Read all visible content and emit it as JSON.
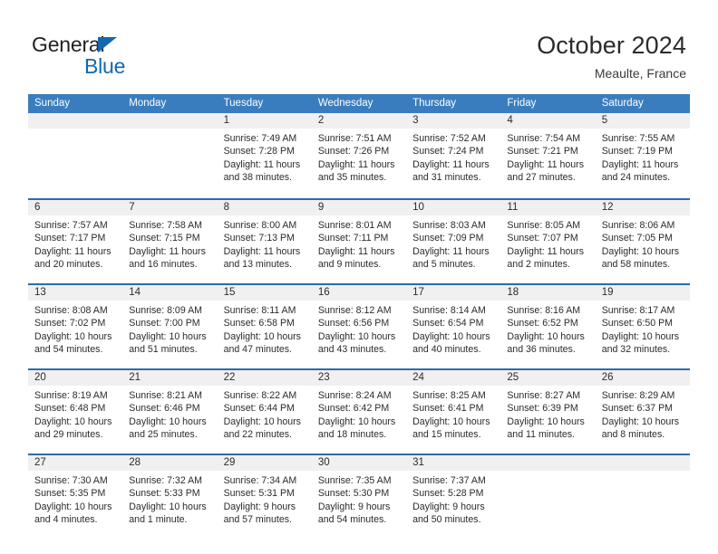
{
  "brand": {
    "name_part1": "General",
    "name_part2": "Blue",
    "triangle_icon": "blue-triangle-icon",
    "color_dark": "#231f20",
    "color_blue": "#1269b0"
  },
  "header": {
    "title": "October 2024",
    "subtitle": "Meaulte, France"
  },
  "theme": {
    "header_bg": "#3a7dbf",
    "row_divider": "#2b6ca8",
    "day_band_bg": "#f0f0f0",
    "text": "#2b2b2b"
  },
  "weekdays": [
    "Sunday",
    "Monday",
    "Tuesday",
    "Wednesday",
    "Thursday",
    "Friday",
    "Saturday"
  ],
  "weeks": [
    [
      {
        "day": "",
        "empty": true,
        "sunrise": "",
        "sunset": "",
        "daylight_line1": "",
        "daylight_line2": ""
      },
      {
        "day": "",
        "empty": true,
        "sunrise": "",
        "sunset": "",
        "daylight_line1": "",
        "daylight_line2": ""
      },
      {
        "day": "1",
        "sunrise": "Sunrise: 7:49 AM",
        "sunset": "Sunset: 7:28 PM",
        "daylight_line1": "Daylight: 11 hours",
        "daylight_line2": "and 38 minutes."
      },
      {
        "day": "2",
        "sunrise": "Sunrise: 7:51 AM",
        "sunset": "Sunset: 7:26 PM",
        "daylight_line1": "Daylight: 11 hours",
        "daylight_line2": "and 35 minutes."
      },
      {
        "day": "3",
        "sunrise": "Sunrise: 7:52 AM",
        "sunset": "Sunset: 7:24 PM",
        "daylight_line1": "Daylight: 11 hours",
        "daylight_line2": "and 31 minutes."
      },
      {
        "day": "4",
        "sunrise": "Sunrise: 7:54 AM",
        "sunset": "Sunset: 7:21 PM",
        "daylight_line1": "Daylight: 11 hours",
        "daylight_line2": "and 27 minutes."
      },
      {
        "day": "5",
        "sunrise": "Sunrise: 7:55 AM",
        "sunset": "Sunset: 7:19 PM",
        "daylight_line1": "Daylight: 11 hours",
        "daylight_line2": "and 24 minutes."
      }
    ],
    [
      {
        "day": "6",
        "sunrise": "Sunrise: 7:57 AM",
        "sunset": "Sunset: 7:17 PM",
        "daylight_line1": "Daylight: 11 hours",
        "daylight_line2": "and 20 minutes."
      },
      {
        "day": "7",
        "sunrise": "Sunrise: 7:58 AM",
        "sunset": "Sunset: 7:15 PM",
        "daylight_line1": "Daylight: 11 hours",
        "daylight_line2": "and 16 minutes."
      },
      {
        "day": "8",
        "sunrise": "Sunrise: 8:00 AM",
        "sunset": "Sunset: 7:13 PM",
        "daylight_line1": "Daylight: 11 hours",
        "daylight_line2": "and 13 minutes."
      },
      {
        "day": "9",
        "sunrise": "Sunrise: 8:01 AM",
        "sunset": "Sunset: 7:11 PM",
        "daylight_line1": "Daylight: 11 hours",
        "daylight_line2": "and 9 minutes."
      },
      {
        "day": "10",
        "sunrise": "Sunrise: 8:03 AM",
        "sunset": "Sunset: 7:09 PM",
        "daylight_line1": "Daylight: 11 hours",
        "daylight_line2": "and 5 minutes."
      },
      {
        "day": "11",
        "sunrise": "Sunrise: 8:05 AM",
        "sunset": "Sunset: 7:07 PM",
        "daylight_line1": "Daylight: 11 hours",
        "daylight_line2": "and 2 minutes."
      },
      {
        "day": "12",
        "sunrise": "Sunrise: 8:06 AM",
        "sunset": "Sunset: 7:05 PM",
        "daylight_line1": "Daylight: 10 hours",
        "daylight_line2": "and 58 minutes."
      }
    ],
    [
      {
        "day": "13",
        "sunrise": "Sunrise: 8:08 AM",
        "sunset": "Sunset: 7:02 PM",
        "daylight_line1": "Daylight: 10 hours",
        "daylight_line2": "and 54 minutes."
      },
      {
        "day": "14",
        "sunrise": "Sunrise: 8:09 AM",
        "sunset": "Sunset: 7:00 PM",
        "daylight_line1": "Daylight: 10 hours",
        "daylight_line2": "and 51 minutes."
      },
      {
        "day": "15",
        "sunrise": "Sunrise: 8:11 AM",
        "sunset": "Sunset: 6:58 PM",
        "daylight_line1": "Daylight: 10 hours",
        "daylight_line2": "and 47 minutes."
      },
      {
        "day": "16",
        "sunrise": "Sunrise: 8:12 AM",
        "sunset": "Sunset: 6:56 PM",
        "daylight_line1": "Daylight: 10 hours",
        "daylight_line2": "and 43 minutes."
      },
      {
        "day": "17",
        "sunrise": "Sunrise: 8:14 AM",
        "sunset": "Sunset: 6:54 PM",
        "daylight_line1": "Daylight: 10 hours",
        "daylight_line2": "and 40 minutes."
      },
      {
        "day": "18",
        "sunrise": "Sunrise: 8:16 AM",
        "sunset": "Sunset: 6:52 PM",
        "daylight_line1": "Daylight: 10 hours",
        "daylight_line2": "and 36 minutes."
      },
      {
        "day": "19",
        "sunrise": "Sunrise: 8:17 AM",
        "sunset": "Sunset: 6:50 PM",
        "daylight_line1": "Daylight: 10 hours",
        "daylight_line2": "and 32 minutes."
      }
    ],
    [
      {
        "day": "20",
        "sunrise": "Sunrise: 8:19 AM",
        "sunset": "Sunset: 6:48 PM",
        "daylight_line1": "Daylight: 10 hours",
        "daylight_line2": "and 29 minutes."
      },
      {
        "day": "21",
        "sunrise": "Sunrise: 8:21 AM",
        "sunset": "Sunset: 6:46 PM",
        "daylight_line1": "Daylight: 10 hours",
        "daylight_line2": "and 25 minutes."
      },
      {
        "day": "22",
        "sunrise": "Sunrise: 8:22 AM",
        "sunset": "Sunset: 6:44 PM",
        "daylight_line1": "Daylight: 10 hours",
        "daylight_line2": "and 22 minutes."
      },
      {
        "day": "23",
        "sunrise": "Sunrise: 8:24 AM",
        "sunset": "Sunset: 6:42 PM",
        "daylight_line1": "Daylight: 10 hours",
        "daylight_line2": "and 18 minutes."
      },
      {
        "day": "24",
        "sunrise": "Sunrise: 8:25 AM",
        "sunset": "Sunset: 6:41 PM",
        "daylight_line1": "Daylight: 10 hours",
        "daylight_line2": "and 15 minutes."
      },
      {
        "day": "25",
        "sunrise": "Sunrise: 8:27 AM",
        "sunset": "Sunset: 6:39 PM",
        "daylight_line1": "Daylight: 10 hours",
        "daylight_line2": "and 11 minutes."
      },
      {
        "day": "26",
        "sunrise": "Sunrise: 8:29 AM",
        "sunset": "Sunset: 6:37 PM",
        "daylight_line1": "Daylight: 10 hours",
        "daylight_line2": "and 8 minutes."
      }
    ],
    [
      {
        "day": "27",
        "sunrise": "Sunrise: 7:30 AM",
        "sunset": "Sunset: 5:35 PM",
        "daylight_line1": "Daylight: 10 hours",
        "daylight_line2": "and 4 minutes."
      },
      {
        "day": "28",
        "sunrise": "Sunrise: 7:32 AM",
        "sunset": "Sunset: 5:33 PM",
        "daylight_line1": "Daylight: 10 hours",
        "daylight_line2": "and 1 minute."
      },
      {
        "day": "29",
        "sunrise": "Sunrise: 7:34 AM",
        "sunset": "Sunset: 5:31 PM",
        "daylight_line1": "Daylight: 9 hours",
        "daylight_line2": "and 57 minutes."
      },
      {
        "day": "30",
        "sunrise": "Sunrise: 7:35 AM",
        "sunset": "Sunset: 5:30 PM",
        "daylight_line1": "Daylight: 9 hours",
        "daylight_line2": "and 54 minutes."
      },
      {
        "day": "31",
        "sunrise": "Sunrise: 7:37 AM",
        "sunset": "Sunset: 5:28 PM",
        "daylight_line1": "Daylight: 9 hours",
        "daylight_line2": "and 50 minutes."
      },
      {
        "day": "",
        "empty": true,
        "sunrise": "",
        "sunset": "",
        "daylight_line1": "",
        "daylight_line2": ""
      },
      {
        "day": "",
        "empty": true,
        "sunrise": "",
        "sunset": "",
        "daylight_line1": "",
        "daylight_line2": ""
      }
    ]
  ]
}
